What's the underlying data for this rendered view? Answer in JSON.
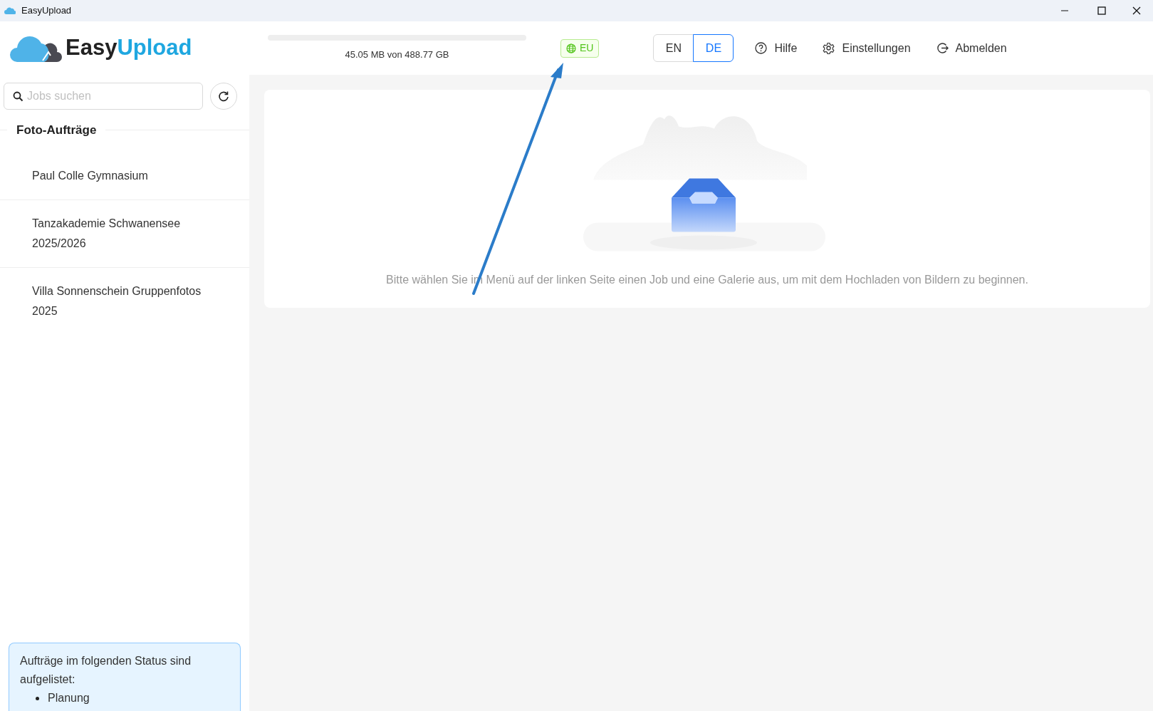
{
  "window": {
    "title": "EasyUpload"
  },
  "header": {
    "logo": {
      "part_1": "Easy",
      "part_2": "Upload"
    },
    "storage": {
      "reading": "45.05 MB von 488.77 GB"
    },
    "region": "EU",
    "languages": [
      {
        "label": "EN",
        "selected": false
      },
      {
        "label": "DE",
        "selected": true
      }
    ],
    "links": [
      {
        "kind": "help",
        "label": "Hilfe"
      },
      {
        "kind": "settings",
        "label": "Einstellungen"
      },
      {
        "kind": "logout",
        "label": "Abmelden"
      }
    ]
  },
  "sidebar": {
    "search": {
      "placeholder": "Jobs suchen"
    },
    "heading": "Foto-Aufträge",
    "items": [
      {
        "label": "Paul Colle Gymnasium"
      },
      {
        "label": "Tanzakademie Schwanensee 2025/2026"
      },
      {
        "label": "Villa Sonnenschein Gruppenfotos 2025"
      }
    ],
    "info": {
      "text": "Aufträge im folgenden Status sind aufgelistet:",
      "statuses": [
        "Planung"
      ]
    }
  },
  "main": {
    "empty_message": "Bitte wählen Sie im Menü auf der linken Seite einen Job und eine Galerie aus, um mit dem Hochladen von Bildern zu beginnen."
  }
}
